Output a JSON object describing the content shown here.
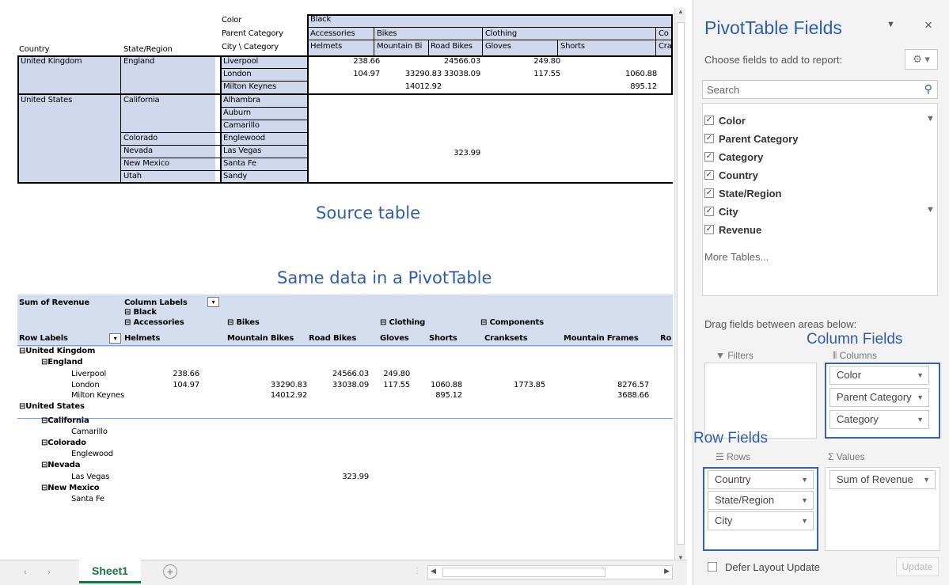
{
  "source": {
    "caption": "Source table",
    "hdr_labels": {
      "color": "Color",
      "parent": "Parent Category",
      "citycat": "City \\ Category",
      "country": "Country",
      "state": "State/Region"
    },
    "col_black": "Black",
    "col_parents": [
      "Accessories",
      "Bikes",
      "Clothing",
      "Co"
    ],
    "col_cats": [
      "Helmets",
      "Mountain Bi",
      "Road Bikes",
      "Gloves",
      "Shorts",
      "Cra"
    ],
    "rows": [
      {
        "country": "United Kingdom",
        "state": "England",
        "city": "Liverpool",
        "v1": "238.66",
        "v2": "",
        "v3": "24566.03",
        "v4": "249.80",
        "v5": ""
      },
      {
        "country": "",
        "state": "",
        "city": "London",
        "v1": "104.97",
        "v2": "33290.83",
        "v3": "33038.09",
        "v4": "117.55",
        "v5": "1060.88"
      },
      {
        "country": "",
        "state": "",
        "city": "Milton Keynes",
        "v1": "",
        "v2": "14012.92",
        "v3": "",
        "v4": "",
        "v5": "895.12"
      },
      {
        "country": "United States",
        "state": "California",
        "city": "Alhambra"
      },
      {
        "country": "",
        "state": "",
        "city": "Auburn"
      },
      {
        "country": "",
        "state": "",
        "city": "Camarillo"
      },
      {
        "country": "",
        "state": "Colorado",
        "city": "Englewood"
      },
      {
        "country": "",
        "state": "Nevada",
        "city": "Las Vegas",
        "v3": "323.99"
      },
      {
        "country": "",
        "state": "New Mexico",
        "city": "Santa Fe"
      },
      {
        "country": "",
        "state": "Utah",
        "city": "Sandy"
      }
    ]
  },
  "pivot": {
    "caption": "Same data in a PivotTable",
    "sum_label": "Sum of Revenue",
    "col_labels": "Column Labels",
    "row_labels": "Row Labels",
    "black": "Black",
    "accessories": "Accessories",
    "bikes": "Bikes",
    "clothing": "Clothing",
    "components": "Components",
    "cols": [
      "Helmets",
      "Mountain Bikes",
      "Road Bikes",
      "Gloves",
      "Shorts",
      "Cranksets",
      "Mountain Frames",
      "Ro"
    ],
    "uk": "United Kingdom",
    "england": "England",
    "liverpool": "Liverpool",
    "london": "London",
    "milton": "Milton Keynes",
    "us": "United States",
    "california": "California",
    "camarillo": "Camarillo",
    "colorado": "Colorado",
    "englewood": "Englewood",
    "nevada": "Nevada",
    "lasvegas": "Las Vegas",
    "newmexico": "New Mexico",
    "santafe": "Santa Fe",
    "vals": {
      "liv_helmets": "238.66",
      "liv_road": "24566.03",
      "liv_gloves": "249.80",
      "lon_helmets": "104.97",
      "lon_mtb": "33290.83",
      "lon_road": "33038.09",
      "lon_gloves": "117.55",
      "lon_shorts": "1060.88",
      "lon_crank": "1773.85",
      "lon_frames": "8276.57",
      "mil_mtb": "14012.92",
      "mil_shorts": "895.12",
      "mil_frames": "3688.66",
      "lv_road": "323.99"
    }
  },
  "pane": {
    "title": "PivotTable Fields",
    "choose": "Choose fields to add to report:",
    "search_placeholder": "Search",
    "fields": [
      "Color",
      "Parent Category",
      "Category",
      "Country",
      "State/Region",
      "City",
      "Revenue"
    ],
    "more": "More Tables...",
    "drag": "Drag fields between areas below:",
    "filters": "Filters",
    "columns": "Columns",
    "rows": "Rows",
    "values": "Values",
    "col_items": [
      "Color",
      "Parent Category",
      "Category"
    ],
    "row_items": [
      "Country",
      "State/Region",
      "City"
    ],
    "value_items": [
      "Sum of Revenue"
    ],
    "col_fields_caption": "Column Fields",
    "row_fields_caption": "Row Fields",
    "defer": "Defer Layout Update",
    "update": "Update"
  },
  "sheet": {
    "tab": "Sheet1"
  },
  "colors": {
    "accent": "#2e5eab",
    "header_fill": "#cfd8ec",
    "tab_green": "#1e7145"
  }
}
